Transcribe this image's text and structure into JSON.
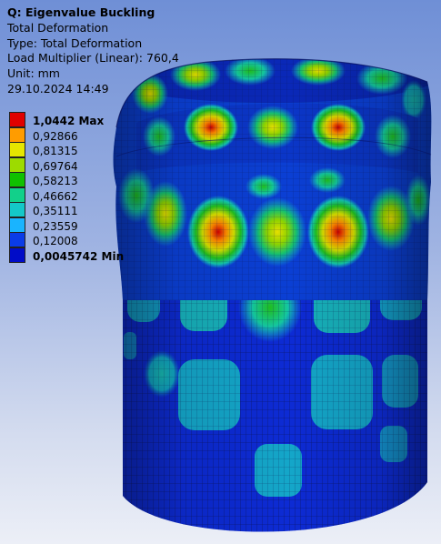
{
  "info": {
    "title": "Q: Eigenvalue Buckling",
    "line1": "Total Deformation",
    "line2": "Type: Total Deformation",
    "line3": "Load Multiplier (Linear): 760,4",
    "line4": "Unit: mm",
    "line5": "29.10.2024 14:49"
  },
  "legend": [
    {
      "label": "1,0442 Max",
      "color": "#e00000",
      "bold": true
    },
    {
      "label": "0,92866",
      "color": "#ff9c00",
      "bold": false
    },
    {
      "label": "0,81315",
      "color": "#e6e600",
      "bold": false
    },
    {
      "label": "0,69764",
      "color": "#9ddb00",
      "bold": false
    },
    {
      "label": "0,58213",
      "color": "#10c000",
      "bold": false
    },
    {
      "label": "0,46662",
      "color": "#12d08a",
      "bold": false
    },
    {
      "label": "0,35111",
      "color": "#14c8c8",
      "bold": false
    },
    {
      "label": "0,23559",
      "color": "#19b4ff",
      "bold": false
    },
    {
      "label": "0,12008",
      "color": "#0a3ce8",
      "bold": false
    },
    {
      "label": "0,0045742 Min",
      "color": "#000cc8",
      "bold": true
    }
  ]
}
